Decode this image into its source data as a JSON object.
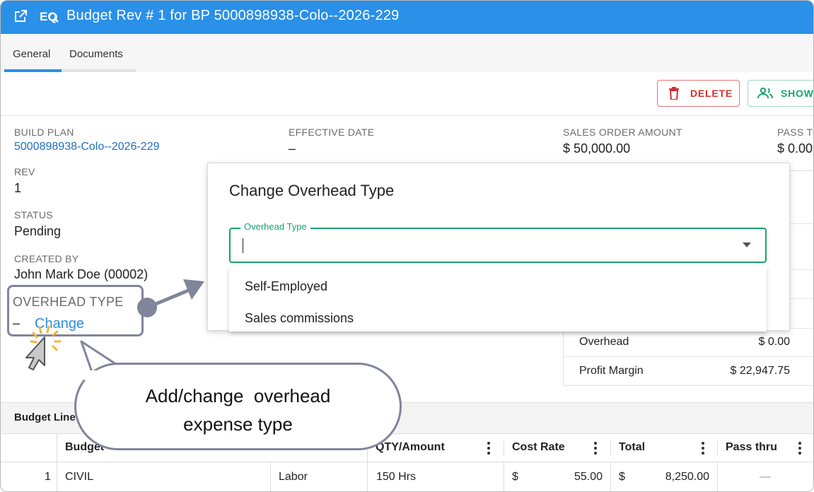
{
  "window": {
    "title": "Budget Rev # 1 for BP 5000898938-Colo--2026-229",
    "icons": [
      "open-external-icon",
      "eq-search-icon"
    ]
  },
  "tabs": [
    {
      "label": "General",
      "active": true
    },
    {
      "label": "Documents",
      "active": false
    }
  ],
  "toolbar": {
    "delete_label": "DELETE",
    "show_label": "SHOW"
  },
  "details": {
    "build_plan_label": "BUILD PLAN",
    "build_plan_value": "5000898938-Colo--2026-229",
    "effective_date_label": "EFFECTIVE DATE",
    "effective_date_value": "–",
    "sales_order_label": "SALES ORDER AMOUNT",
    "sales_order_value": "$ 50,000.00",
    "pass_label": "PASS T",
    "pass_value": "$ 0.00",
    "rev_label": "REV",
    "rev_value": "1",
    "status_label": "STATUS",
    "status_value": "Pending",
    "created_by_label": "CREATED BY",
    "created_by_value": "John Mark Doe (00002)",
    "overhead_type_label": "OVERHEAD TYPE",
    "overhead_type_value": "–",
    "change_link": "Change"
  },
  "summary": [
    {
      "label": "Overhead",
      "value": "$ 0.00"
    },
    {
      "label": "Profit Margin",
      "value": "$ 22,947.75"
    }
  ],
  "dialog": {
    "title": "Change Overhead Type",
    "field_label": "Overhead Type",
    "field_value": "",
    "options": [
      "Self-Employed",
      "Sales commissions"
    ]
  },
  "callout": {
    "line1": "Add/change  overhead",
    "line2": "expense type"
  },
  "budget_lines": {
    "section_title": "Budget Line",
    "columns": [
      "Budget",
      "QTY/Amount",
      "Cost Rate",
      "Total",
      "Pass thru"
    ],
    "rows": [
      {
        "num": "1",
        "budget": "CIVIL",
        "type": "Labor",
        "qty": "150 Hrs",
        "rate_cur": "$",
        "rate": "55.00",
        "total_cur": "$",
        "total": "8,250.00",
        "pass": "—"
      }
    ]
  },
  "colors": {
    "titlebar": "#2a90e8",
    "accent_green": "#1aa36f",
    "delete_red": "#d32f2f",
    "link": "#1e6fbf",
    "callout": "#80859b"
  }
}
